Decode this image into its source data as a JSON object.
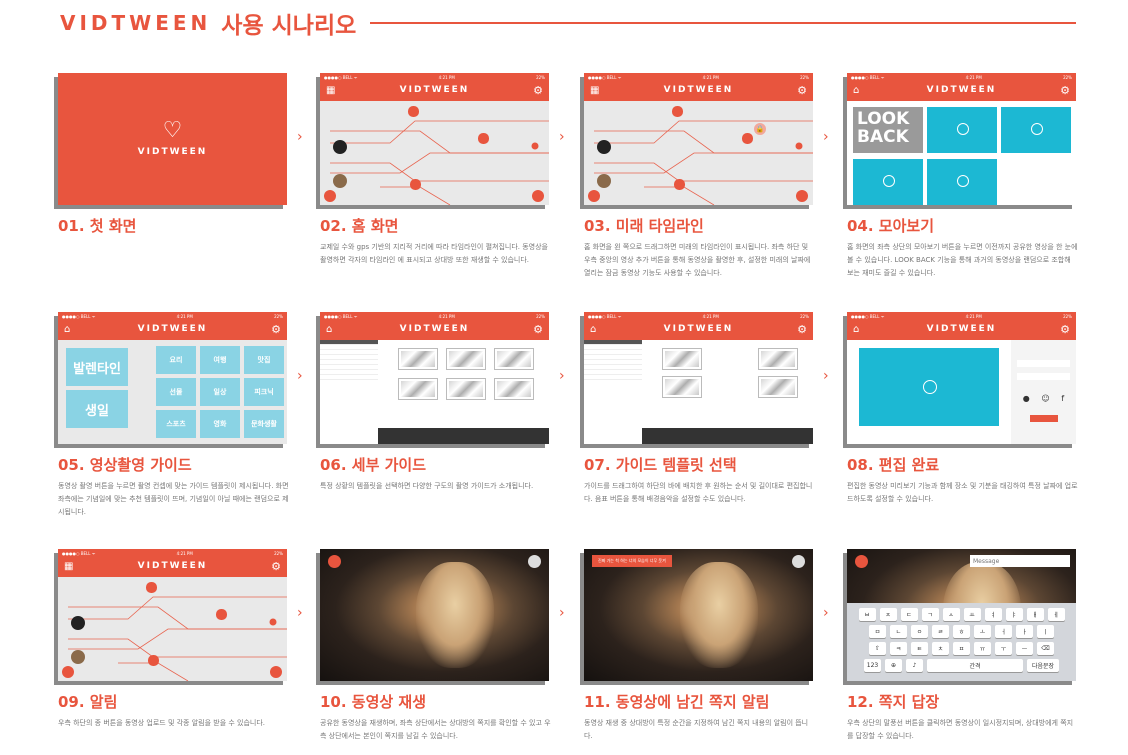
{
  "header": {
    "brand": "VIDTWEEN",
    "title": "사용 시나리오"
  },
  "app": {
    "name": "VIDTWEEN",
    "status_left": "●●●●○ BELL ᯤ",
    "status_time": "4:21 PM",
    "status_right": "22%"
  },
  "accent": "#e8553e",
  "cards": [
    {
      "title": "01. 첫 화면",
      "desc": ""
    },
    {
      "title": "02. 홈 화면",
      "desc": "교제일 수와 gps 기반의 지리적 거리에 따라 타임라인이 펼쳐집니다. 동영상을 촬영하면 각자의 타임라인 에 표시되고 상대방 또한 재생할 수 있습니다."
    },
    {
      "title": "03. 미래 타임라인",
      "desc": "홈 화면을 왼 쪽으로 드래그하면 미래의 타임라인이 표시됩니다. 좌측 하단 및 우측 중앙의 영상 추가 버튼을 통해 동영상을 촬영한 후, 설정한 미래의 날짜에 열리는 잠금 동영상 기능도 사용할 수 있습니다."
    },
    {
      "title": "04. 모아보기",
      "desc": "홈 화면의 좌측 상단의 모아보기 버튼을 누르면 이전까지 공유한 영상을 한 눈에 볼 수 있습니다. LOOK BACK 기능을 통해 과거의 동영상을 랜덤으로 조합해 보는 재미도 즐길 수 있습니다."
    },
    {
      "title": "05. 영상촬영 가이드",
      "desc": "동영상 촬영 버튼을 누르면 촬영 컨셉에 맞는 가이드 템플릿이 제시됩니다. 화면 좌측에는 기념일에 맞는 추천 템플릿이 뜨며, 기념일이 아닐 때에는 랜덤으로 제시됩니다."
    },
    {
      "title": "06. 세부 가이드",
      "desc": "특정 상황의 템플릿을 선택하면 다양한 구도의 촬영 가이드가 소개됩니다."
    },
    {
      "title": "07. 가이드 템플릿 선택",
      "desc": "가이드를 드래그하여 하단의 바에 배치한 후 원하는 순서 및 길이대로 편집합니다. 음표 버튼을 통해 배경음악을 설정할 수도 있습니다."
    },
    {
      "title": "08. 편집 완료",
      "desc": "편집한 동영상 미리보기 기능과 함께 장소 및 기분을 태깅하여 특정 날짜에 업로드하도록 설정할 수 있습니다."
    },
    {
      "title": "09. 알림",
      "desc": "우측 하단의 종 버튼을 동영상 업로드 및 각종 알림을 받을 수 있습니다."
    },
    {
      "title": "10. 동영상 재생",
      "desc": "공유한 동영상을 재생하며, 좌측 상단에서는 상대방의 쪽지를 확인할 수 있고 우측 상단에서는 본인이 쪽지를 남길 수 있습니다."
    },
    {
      "title": "11. 동영상에 남긴 쪽지 알림",
      "desc": "동영상 재생 중 상대방이 특정 순간을 지정하여 남긴 쪽지 내용의 알림이 뜹니다."
    },
    {
      "title": "12. 쪽지 답장",
      "desc": "우측 상단의 말풍선 버튼을 클릭하면 동영상이 일시정지되며, 상대방에게 쪽지를 답장할 수 있습니다."
    }
  ],
  "screens": {
    "lookback": "LOOK BACK",
    "guide_tiles_left": [
      "발렌타인",
      "생일"
    ],
    "guide_tiles": [
      "요리",
      "여행",
      "맛집",
      "선물",
      "일상",
      "피크닉",
      "스포츠",
      "영화",
      "문화생활"
    ],
    "note_toast": "진짜 가는 척 하는 너의 모습이 너무 웃겨",
    "message_placeholder": "Message",
    "kb_rows": [
      [
        "ㅂ",
        "ㅈ",
        "ㄷ",
        "ㄱ",
        "ㅅ",
        "ㅛ",
        "ㅕ",
        "ㅑ",
        "ㅐ",
        "ㅔ"
      ],
      [
        "ㅁ",
        "ㄴ",
        "ㅇ",
        "ㄹ",
        "ㅎ",
        "ㅗ",
        "ㅓ",
        "ㅏ",
        "ㅣ"
      ],
      [
        "⇧",
        "ㅋ",
        "ㅌ",
        "ㅊ",
        "ㅍ",
        "ㅠ",
        "ㅜ",
        "ㅡ",
        "⌫"
      ]
    ],
    "kb_bottom": {
      "num": "123",
      "space": "간격",
      "next": "다음문장"
    }
  }
}
